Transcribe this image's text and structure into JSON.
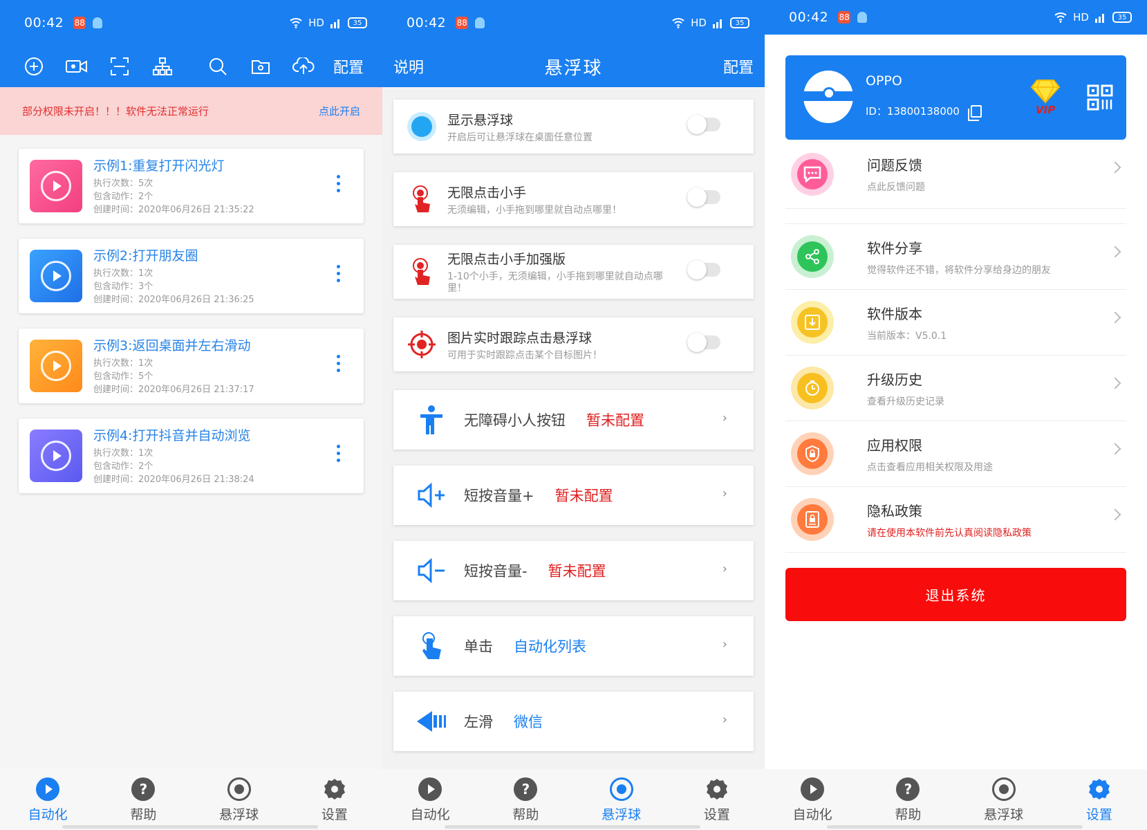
{
  "status": {
    "time": "00:42",
    "badge": "88",
    "network": "HD",
    "battery": "35"
  },
  "screen1": {
    "toolbar": {
      "config_label": "配置"
    },
    "warning": {
      "text": "部分权限未开启！！！软件无法正常运行",
      "action": "点此开启"
    },
    "items": [
      {
        "title": "示例1:重复打开闪光灯",
        "runs": "执行次数：5次",
        "actions": "包含动作：2个",
        "created": "创建时间：2020年06月26日 21:35:22"
      },
      {
        "title": "示例2:打开朋友圈",
        "runs": "执行次数：1次",
        "actions": "包含动作：3个",
        "created": "创建时间：2020年06月26日 21:36:25"
      },
      {
        "title": "示例3:返回桌面并左右滑动",
        "runs": "执行次数：1次",
        "actions": "包含动作：5个",
        "created": "创建时间：2020年06月26日 21:37:17"
      },
      {
        "title": "示例4:打开抖音并自动浏览",
        "runs": "执行次数：1次",
        "actions": "包含动作：2个",
        "created": "创建时间：2020年06月26日 21:38:24"
      }
    ]
  },
  "screen2": {
    "toolbar": {
      "left": "说明",
      "title": "悬浮球",
      "right": "配置"
    },
    "toggles": [
      {
        "title": "显示悬浮球",
        "desc": "开启后可让悬浮球在桌面任意位置"
      },
      {
        "title": "无限点击小手",
        "desc": "无须编辑，小手拖到哪里就自动点哪里！"
      },
      {
        "title": "无限点击小手加强版",
        "desc": "1-10个小手，无须编辑，小手拖到哪里就自动点哪里！"
      },
      {
        "title": "图片实时跟踪点击悬浮球",
        "desc": "可用于实时跟踪点击某个目标图片！"
      }
    ],
    "configs": [
      {
        "label": "无障碍小人按钮",
        "value": "暂未配置"
      },
      {
        "label": "短按音量+",
        "value": "暂未配置"
      },
      {
        "label": "短按音量-",
        "value": "暂未配置"
      },
      {
        "label": "单击",
        "value": "自动化列表"
      },
      {
        "label": "左滑",
        "value": "微信"
      }
    ],
    "chevron": "›"
  },
  "screen3": {
    "profile": {
      "name": "OPPO",
      "id": "ID：13800138000",
      "vip": "VIP"
    },
    "items": [
      {
        "title": "问题反馈",
        "desc": "点此反馈问题"
      },
      {
        "title": "软件分享",
        "desc": "觉得软件还不错，将软件分享给身边的朋友"
      },
      {
        "title": "软件版本",
        "desc": "当前版本：V5.0.1"
      },
      {
        "title": "升级历史",
        "desc": "查看升级历史记录"
      },
      {
        "title": "应用权限",
        "desc": "点击查看应用相关权限及用途"
      },
      {
        "title": "隐私政策",
        "desc": "请在使用本软件前先认真阅读隐私政策"
      }
    ],
    "logout": "退出系统"
  },
  "nav": {
    "automation": "自动化",
    "help": "帮助",
    "float": "悬浮球",
    "settings": "设置"
  },
  "colors": {
    "primary": "#1a7ff0",
    "danger": "#f80c0c",
    "warning_bg": "#fbd4d4"
  }
}
